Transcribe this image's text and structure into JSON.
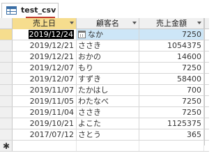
{
  "tab": {
    "title": "test_csv"
  },
  "columns": {
    "date": "売上日",
    "name": "顧客名",
    "amount": "売上金額"
  },
  "rows": [
    {
      "date": "2019/12/24",
      "name": "なか",
      "amount": "7250"
    },
    {
      "date": "2019/12/21",
      "name": "ささき",
      "amount": "1054375"
    },
    {
      "date": "2019/12/21",
      "name": "おかの",
      "amount": "14600"
    },
    {
      "date": "2019/12/07",
      "name": "もり",
      "amount": "7250"
    },
    {
      "date": "2019/12/07",
      "name": "すずき",
      "amount": "58400"
    },
    {
      "date": "2019/11/07",
      "name": "たかはし",
      "amount": "700"
    },
    {
      "date": "2019/11/05",
      "name": "わたなべ",
      "amount": "7250"
    },
    {
      "date": "2019/11/04",
      "name": "ささき",
      "amount": "7250"
    },
    {
      "date": "2019/10/21",
      "name": "よこた",
      "amount": "1125375"
    },
    {
      "date": "2017/07/12",
      "name": "さとう",
      "amount": "365"
    }
  ],
  "new_row_marker": "✱"
}
